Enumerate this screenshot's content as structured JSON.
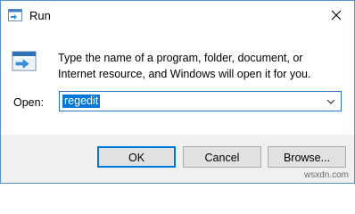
{
  "window": {
    "title": "Run",
    "close_icon": "close-icon"
  },
  "description": "Type the name of a program, folder, document, or Internet resource, and Windows will open it for you.",
  "open_field": {
    "label": "Open:",
    "value": "regedit",
    "dropdown_icon": "chevron-down-icon"
  },
  "buttons": {
    "ok": "OK",
    "cancel": "Cancel",
    "browse": "Browse..."
  },
  "watermark": "wsxdn.com",
  "colors": {
    "accent": "#0078d7",
    "footer_bg": "#f0f0f0",
    "button_bg": "#e1e1e1"
  }
}
